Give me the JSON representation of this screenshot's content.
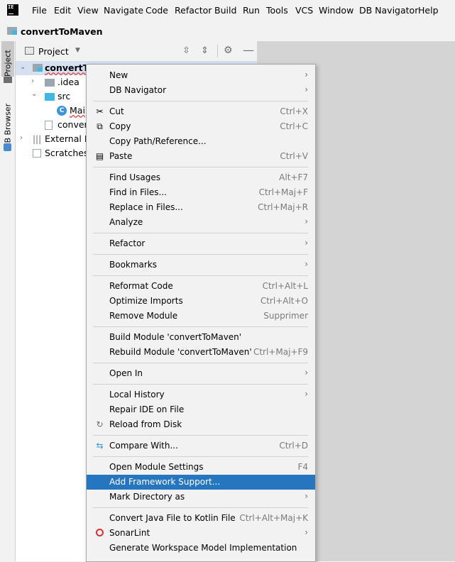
{
  "app": {
    "logo": "IE"
  },
  "menubar": [
    "File",
    "Edit",
    "View",
    "Navigate",
    "Code",
    "Refactor",
    "Build",
    "Run",
    "Tools",
    "VCS",
    "Window",
    "DB Navigator",
    "Help"
  ],
  "breadcrumb": {
    "title": "convertToMaven"
  },
  "left_tabs": {
    "project": "Project",
    "db_browser": "DB Browser"
  },
  "panel": {
    "title": "Project"
  },
  "tree": {
    "root": "convertTo",
    "idea": ".idea",
    "src": "src",
    "main": "Mai",
    "convert": "convert",
    "external": "External Lib",
    "scratches": "Scratches a"
  },
  "context_menu": {
    "groups": [
      [
        {
          "label": "New",
          "submenu": true
        },
        {
          "label": "DB Navigator",
          "submenu": true
        }
      ],
      [
        {
          "label": "Cut",
          "shortcut": "Ctrl+X",
          "icon": "scissors-icon"
        },
        {
          "label": "Copy",
          "shortcut": "Ctrl+C",
          "icon": "copy-icon"
        },
        {
          "label": "Copy Path/Reference..."
        },
        {
          "label": "Paste",
          "shortcut": "Ctrl+V",
          "icon": "paste-icon"
        }
      ],
      [
        {
          "label": "Find Usages",
          "shortcut": "Alt+F7"
        },
        {
          "label": "Find in Files...",
          "shortcut": "Ctrl+Maj+F"
        },
        {
          "label": "Replace in Files...",
          "shortcut": "Ctrl+Maj+R"
        },
        {
          "label": "Analyze",
          "submenu": true
        }
      ],
      [
        {
          "label": "Refactor",
          "submenu": true
        }
      ],
      [
        {
          "label": "Bookmarks",
          "submenu": true
        }
      ],
      [
        {
          "label": "Reformat Code",
          "shortcut": "Ctrl+Alt+L"
        },
        {
          "label": "Optimize Imports",
          "shortcut": "Ctrl+Alt+O"
        },
        {
          "label": "Remove Module",
          "shortcut": "Supprimer"
        }
      ],
      [
        {
          "label": "Build Module 'convertToMaven'"
        },
        {
          "label": "Rebuild Module 'convertToMaven'",
          "shortcut": "Ctrl+Maj+F9"
        }
      ],
      [
        {
          "label": "Open In",
          "submenu": true
        }
      ],
      [
        {
          "label": "Local History",
          "submenu": true
        },
        {
          "label": "Repair IDE on File"
        },
        {
          "label": "Reload from Disk",
          "icon": "reload-icon"
        }
      ],
      [
        {
          "label": "Compare With...",
          "shortcut": "Ctrl+D",
          "icon": "compare-icon"
        }
      ],
      [
        {
          "label": "Open Module Settings",
          "shortcut": "F4"
        },
        {
          "label": "Add Framework Support...",
          "selected": true
        },
        {
          "label": "Mark Directory as",
          "submenu": true
        }
      ],
      [
        {
          "label": "Convert Java File to Kotlin File",
          "shortcut": "Ctrl+Alt+Maj+K"
        },
        {
          "label": "SonarLint",
          "submenu": true,
          "icon": "sonarlint-icon"
        },
        {
          "label": "Generate Workspace Model Implementation"
        }
      ]
    ]
  },
  "colors": {
    "selection": "#2675bf",
    "folder_blue": "#40b6e0",
    "background": "#f2f2f2"
  }
}
